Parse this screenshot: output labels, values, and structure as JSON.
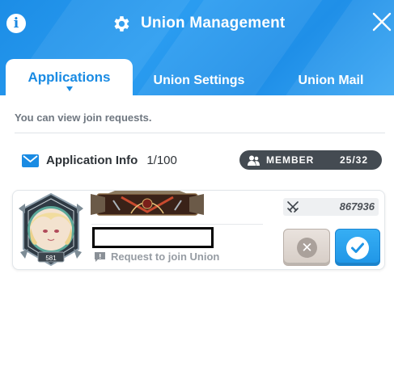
{
  "header": {
    "title": "Union Management",
    "info_glyph": "i"
  },
  "tabs": [
    {
      "label": "Applications",
      "active": true
    },
    {
      "label": "Union Settings",
      "active": false
    },
    {
      "label": "Union Mail",
      "active": false
    }
  ],
  "content": {
    "description": "You can view join requests.",
    "application_info_label": "Application Info",
    "application_count": "1/100",
    "member_label": "MEMBER",
    "member_count": "25/32"
  },
  "applicant": {
    "level": "581",
    "power": "867936",
    "request_text": "Request to join Union"
  },
  "icons": {
    "info": "info-icon",
    "settings": "gear-icon",
    "close": "close-icon",
    "mail": "mail-icon",
    "members": "members-icon",
    "power": "crossed-swords-icon",
    "request": "message-icon",
    "reject": "x-icon",
    "accept": "check-icon"
  },
  "colors": {
    "primary": "#1a8be3",
    "badge": "#444b52",
    "reject": "#aaa19b"
  }
}
